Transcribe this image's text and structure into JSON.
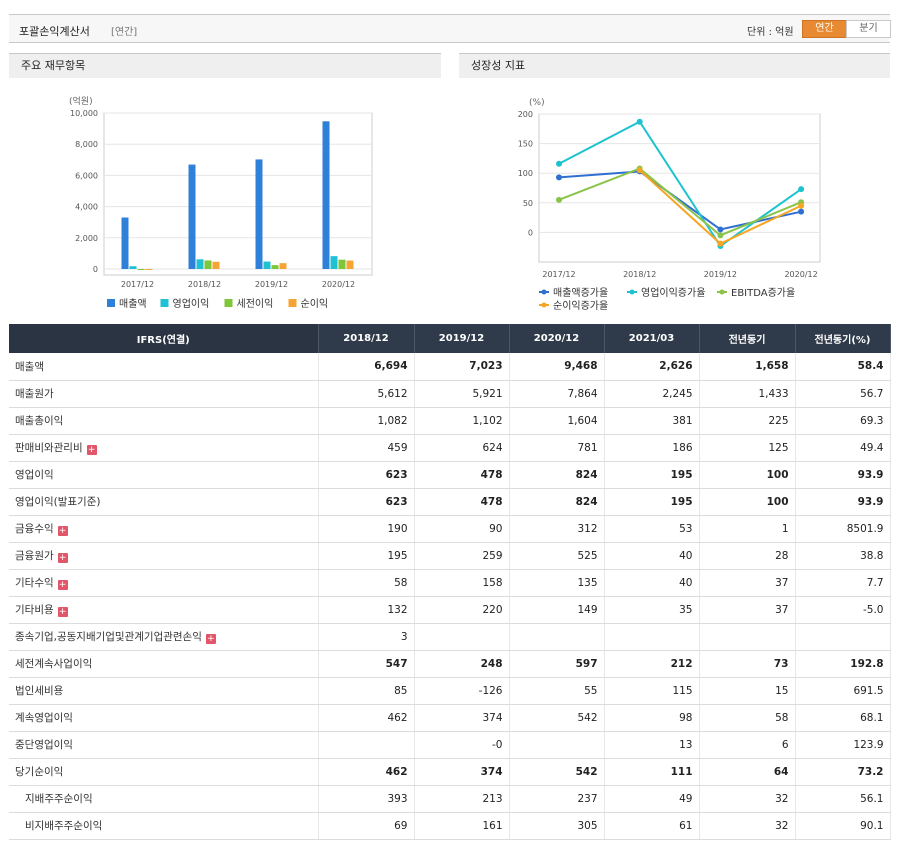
{
  "header": {
    "title": "포괄손익계산서",
    "subtitle": "[연간]",
    "unit": "단위 : 억원",
    "toggle_annual": "연간",
    "toggle_quarter": "분기"
  },
  "panels": {
    "left_title": "주요 재무항목",
    "right_title": "성장성 지표"
  },
  "chart_data": [
    {
      "type": "bar",
      "title": "",
      "ylabel": "(억원)",
      "categories": [
        "2017/12",
        "2018/12",
        "2019/12",
        "2020/12"
      ],
      "ylim": [
        0,
        10000
      ],
      "yticks": [
        "0",
        "2,000",
        "4,000",
        "6,000",
        "8,000",
        "10,000"
      ],
      "series": [
        {
          "name": "매출액",
          "color": "#2f80d8",
          "values": [
            3300,
            6694,
            7023,
            9468
          ]
        },
        {
          "name": "영업이익",
          "color": "#1fc1d2",
          "values": [
            180,
            623,
            478,
            824
          ]
        },
        {
          "name": "세전이익",
          "color": "#7ec63a",
          "values": [
            -50,
            547,
            248,
            597
          ]
        },
        {
          "name": "순이익",
          "color": "#f6a434",
          "values": [
            -60,
            462,
            374,
            542
          ]
        }
      ],
      "legend": "bottom",
      "grid": true
    },
    {
      "type": "line",
      "title": "",
      "ylabel": "(%)",
      "categories": [
        "2017/12",
        "2018/12",
        "2019/12",
        "2020/12"
      ],
      "ylim": [
        -25,
        200
      ],
      "yticks": [
        "0",
        "50",
        "100",
        "150",
        "200"
      ],
      "series": [
        {
          "name": "매출액증가율",
          "color": "#2f6fd1",
          "values": [
            93,
            103,
            5,
            35
          ]
        },
        {
          "name": "영업이익증가율",
          "color": "#1cc3cf",
          "values": [
            116,
            187,
            -23,
            73
          ]
        },
        {
          "name": "EBITDA증가율",
          "color": "#8bc34a",
          "values": [
            55,
            108,
            -5,
            51
          ]
        },
        {
          "name": "순이익증가율",
          "color": "#f5a623",
          "values": [
            null,
            105,
            -19,
            45
          ]
        }
      ],
      "legend": "bottom",
      "grid": true
    }
  ],
  "table": {
    "header": [
      "IFRS(연결)",
      "2018/12",
      "2019/12",
      "2020/12",
      "2021/03",
      "전년동기",
      "전년동기(%)"
    ],
    "rows": [
      {
        "label": "매출액",
        "values": [
          "6,694",
          "7,023",
          "9,468",
          "2,626",
          "1,658",
          "58.4"
        ],
        "bold": true,
        "plus": false
      },
      {
        "label": "매출원가",
        "values": [
          "5,612",
          "5,921",
          "7,864",
          "2,245",
          "1,433",
          "56.7"
        ],
        "bold": false,
        "plus": false
      },
      {
        "label": "매출총이익",
        "values": [
          "1,082",
          "1,102",
          "1,604",
          "381",
          "225",
          "69.3"
        ],
        "bold": false,
        "plus": false
      },
      {
        "label": "판매비와관리비",
        "values": [
          "459",
          "624",
          "781",
          "186",
          "125",
          "49.4"
        ],
        "bold": false,
        "plus": true
      },
      {
        "label": "영업이익",
        "values": [
          "623",
          "478",
          "824",
          "195",
          "100",
          "93.9"
        ],
        "bold": true,
        "plus": false
      },
      {
        "label": "영업이익(발표기준)",
        "values": [
          "623",
          "478",
          "824",
          "195",
          "100",
          "93.9"
        ],
        "bold": true,
        "plus": false
      },
      {
        "label": "금융수익",
        "values": [
          "190",
          "90",
          "312",
          "53",
          "1",
          "8501.9"
        ],
        "bold": false,
        "plus": true
      },
      {
        "label": "금융원가",
        "values": [
          "195",
          "259",
          "525",
          "40",
          "28",
          "38.8"
        ],
        "bold": false,
        "plus": true
      },
      {
        "label": "기타수익",
        "values": [
          "58",
          "158",
          "135",
          "40",
          "37",
          "7.7"
        ],
        "bold": false,
        "plus": true
      },
      {
        "label": "기타비용",
        "values": [
          "132",
          "220",
          "149",
          "35",
          "37",
          "-5.0"
        ],
        "bold": false,
        "plus": true
      },
      {
        "label": "종속기업,공동지배기업및관계기업관련손익",
        "values": [
          "3",
          "",
          "",
          "",
          "",
          ""
        ],
        "bold": false,
        "plus": true
      },
      {
        "label": "세전계속사업이익",
        "values": [
          "547",
          "248",
          "597",
          "212",
          "73",
          "192.8"
        ],
        "bold": true,
        "plus": false
      },
      {
        "label": "법인세비용",
        "values": [
          "85",
          "-126",
          "55",
          "115",
          "15",
          "691.5"
        ],
        "bold": false,
        "plus": false
      },
      {
        "label": "계속영업이익",
        "values": [
          "462",
          "374",
          "542",
          "98",
          "58",
          "68.1"
        ],
        "bold": false,
        "plus": false
      },
      {
        "label": "중단영업이익",
        "values": [
          "",
          "-0",
          "",
          "13",
          "6",
          "123.9"
        ],
        "bold": false,
        "plus": false
      },
      {
        "label": "당기순이익",
        "values": [
          "462",
          "374",
          "542",
          "111",
          "64",
          "73.2"
        ],
        "bold": true,
        "plus": false
      },
      {
        "label": "지배주주순이익",
        "values": [
          "393",
          "213",
          "237",
          "49",
          "32",
          "56.1"
        ],
        "bold": false,
        "plus": false,
        "indent": true
      },
      {
        "label": "비지배주주순이익",
        "values": [
          "69",
          "161",
          "305",
          "61",
          "32",
          "90.1"
        ],
        "bold": false,
        "plus": false,
        "indent": true
      }
    ]
  }
}
